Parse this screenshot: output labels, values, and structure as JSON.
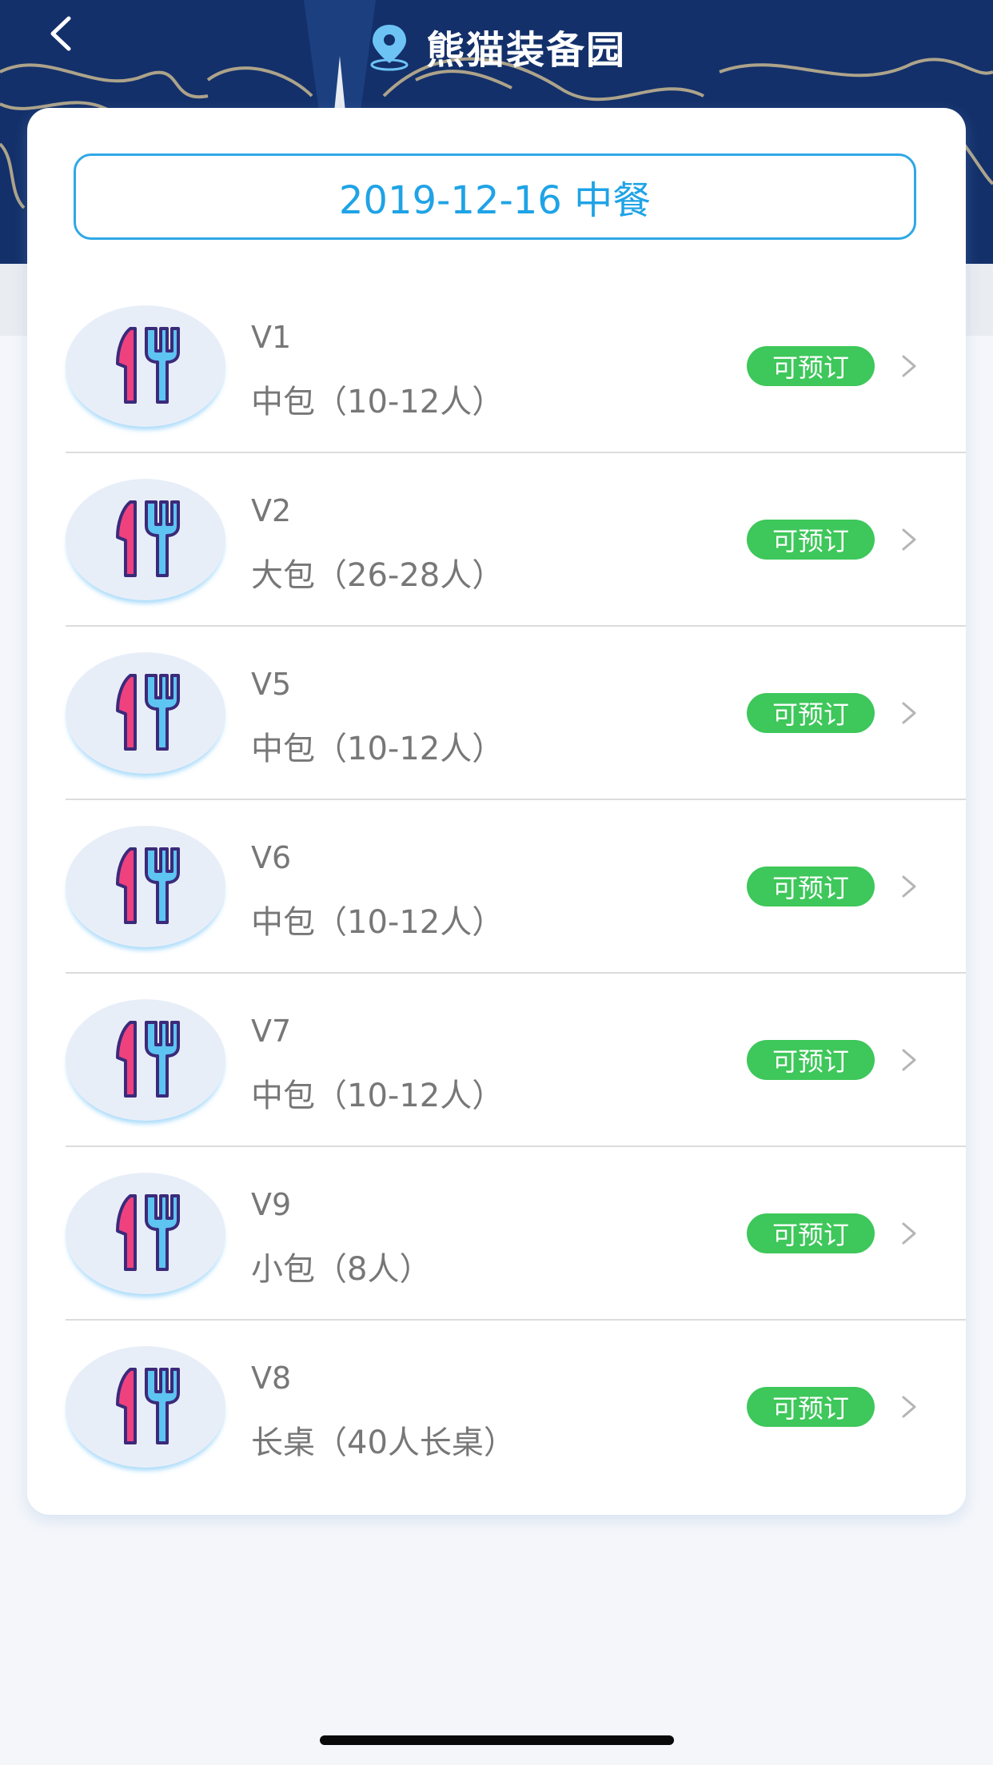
{
  "header": {
    "title": "熊猫装备园",
    "icons": {
      "back": "chevron-left-icon",
      "location": "location-pin-icon"
    },
    "colors": {
      "background": "#13306a",
      "title": "#ffffff",
      "pin": "#6ec3f5"
    }
  },
  "date_selector": {
    "label": "2019-12-16 中餐",
    "color": "#1fa3e6"
  },
  "rooms": [
    {
      "name": "V1",
      "capacity": "中包（10-12人）",
      "status": "可预订"
    },
    {
      "name": "V2",
      "capacity": "大包（26-28人）",
      "status": "可预订"
    },
    {
      "name": "V5",
      "capacity": "中包（10-12人）",
      "status": "可预订"
    },
    {
      "name": "V6",
      "capacity": "中包（10-12人）",
      "status": "可预订"
    },
    {
      "name": "V7",
      "capacity": "中包（10-12人）",
      "status": "可预订"
    },
    {
      "name": "V9",
      "capacity": "小包（8人）",
      "status": "可预订"
    },
    {
      "name": "V8",
      "capacity": "长桌（40人长桌）",
      "status": "可预订"
    }
  ],
  "room_icon": "knife-fork-icon",
  "status_color": "#3ec75a"
}
